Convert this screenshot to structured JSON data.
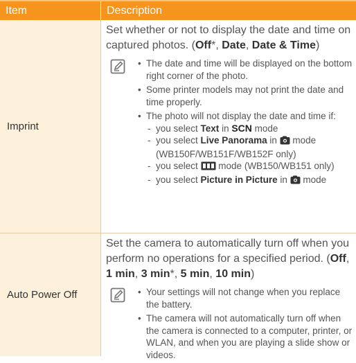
{
  "table": {
    "header": {
      "item": "Item",
      "description": "Description"
    },
    "imprint": {
      "item": "Imprint",
      "desc_prefix": "Set whether or not to display the date and time on captured photos. (",
      "opt_off": "Off",
      "opt_off_mark": "*",
      "sep1": ", ",
      "opt_date": "Date",
      "sep2": ", ",
      "opt_date_time": "Date & Time",
      "desc_suffix": ")",
      "note_bullets": [
        "The date and time will be displayed on the bottom right corner of the photo.",
        "Some printer models may not print the date and time properly.",
        "The photo will not display the date and time if:"
      ],
      "sub1_pre": "you select ",
      "sub1_bold": "Text",
      "sub1_mid": " in ",
      "sub1_scn": "SCN",
      "sub1_post": " mode",
      "sub2_pre": "you select ",
      "sub2_bold": "Live Panorama",
      "sub2_mid": " in ",
      "sub2_post": " mode (WB150F/WB151F/WB152F only)",
      "sub3_pre": "you select ",
      "sub3_post": " mode (WB150/WB151 only)",
      "sub4_pre": "you select ",
      "sub4_bold": "Picture in Picture",
      "sub4_mid": " in ",
      "sub4_post": " mode"
    },
    "auto_power_off": {
      "item": "Auto Power Off",
      "desc_text": "Set the camera to automatically turn off when you perform no operations for a specified period. (",
      "opt_off": "Off",
      "sep1": ", ",
      "opt_1min": "1 min",
      "sep2": ", ",
      "opt_3min": "3 min",
      "opt_3min_mark": "*",
      "sep3": ", ",
      "opt_5min": "5 min",
      "sep4": ", ",
      "opt_10min": "10 min",
      "desc_suffix": ")",
      "note_bullets": [
        "Your settings will not change when you replace the battery.",
        "The camera will not automatically turn off when the camera is connected to a computer, printer, or WLAN, and when you are playing a slide show or videos."
      ]
    }
  },
  "icons": {
    "note": "note-pencil-icon",
    "camera_mode": "smart-camera-icon",
    "panorama_mode": "panorama-mode-icon"
  },
  "colors": {
    "header_bg": "#f7941d",
    "item_bg": "#fef1dc"
  }
}
